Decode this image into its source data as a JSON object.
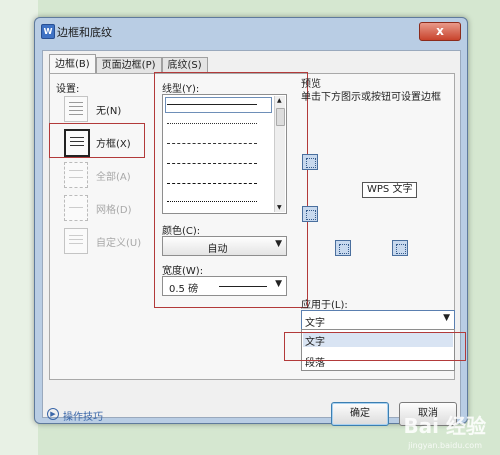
{
  "window": {
    "title": "边框和底纹",
    "app_icon": "W",
    "close_glyph": "x"
  },
  "tabs": [
    {
      "label": "边框(B)",
      "active": true
    },
    {
      "label": "页面边框(P)",
      "active": false
    },
    {
      "label": "底纹(S)",
      "active": false
    }
  ],
  "settings": {
    "label": "设置:",
    "items": [
      {
        "label": "无(N)",
        "enabled": true
      },
      {
        "label": "方框(X)",
        "enabled": true,
        "selected": true
      },
      {
        "label": "全部(A)",
        "enabled": false
      },
      {
        "label": "网格(D)",
        "enabled": false
      },
      {
        "label": "自定义(U)",
        "enabled": false
      }
    ]
  },
  "line_style": {
    "label": "线型(Y):"
  },
  "color": {
    "label": "颜色(C):",
    "value": "自动"
  },
  "width": {
    "label": "宽度(W):",
    "value": "0.5  磅"
  },
  "preview": {
    "label": "预览",
    "hint": "单击下方图示或按钮可设置边框",
    "sample_text": "WPS 文字"
  },
  "apply_to": {
    "label": "应用于(L):",
    "value": "文字",
    "options": [
      "文字",
      "段落"
    ]
  },
  "buttons": {
    "ok": "确定",
    "cancel": "取消"
  },
  "help": {
    "label": "操作技巧"
  },
  "watermark": {
    "text": "Bai 经验",
    "sub": "jingyan.baidu.com"
  }
}
